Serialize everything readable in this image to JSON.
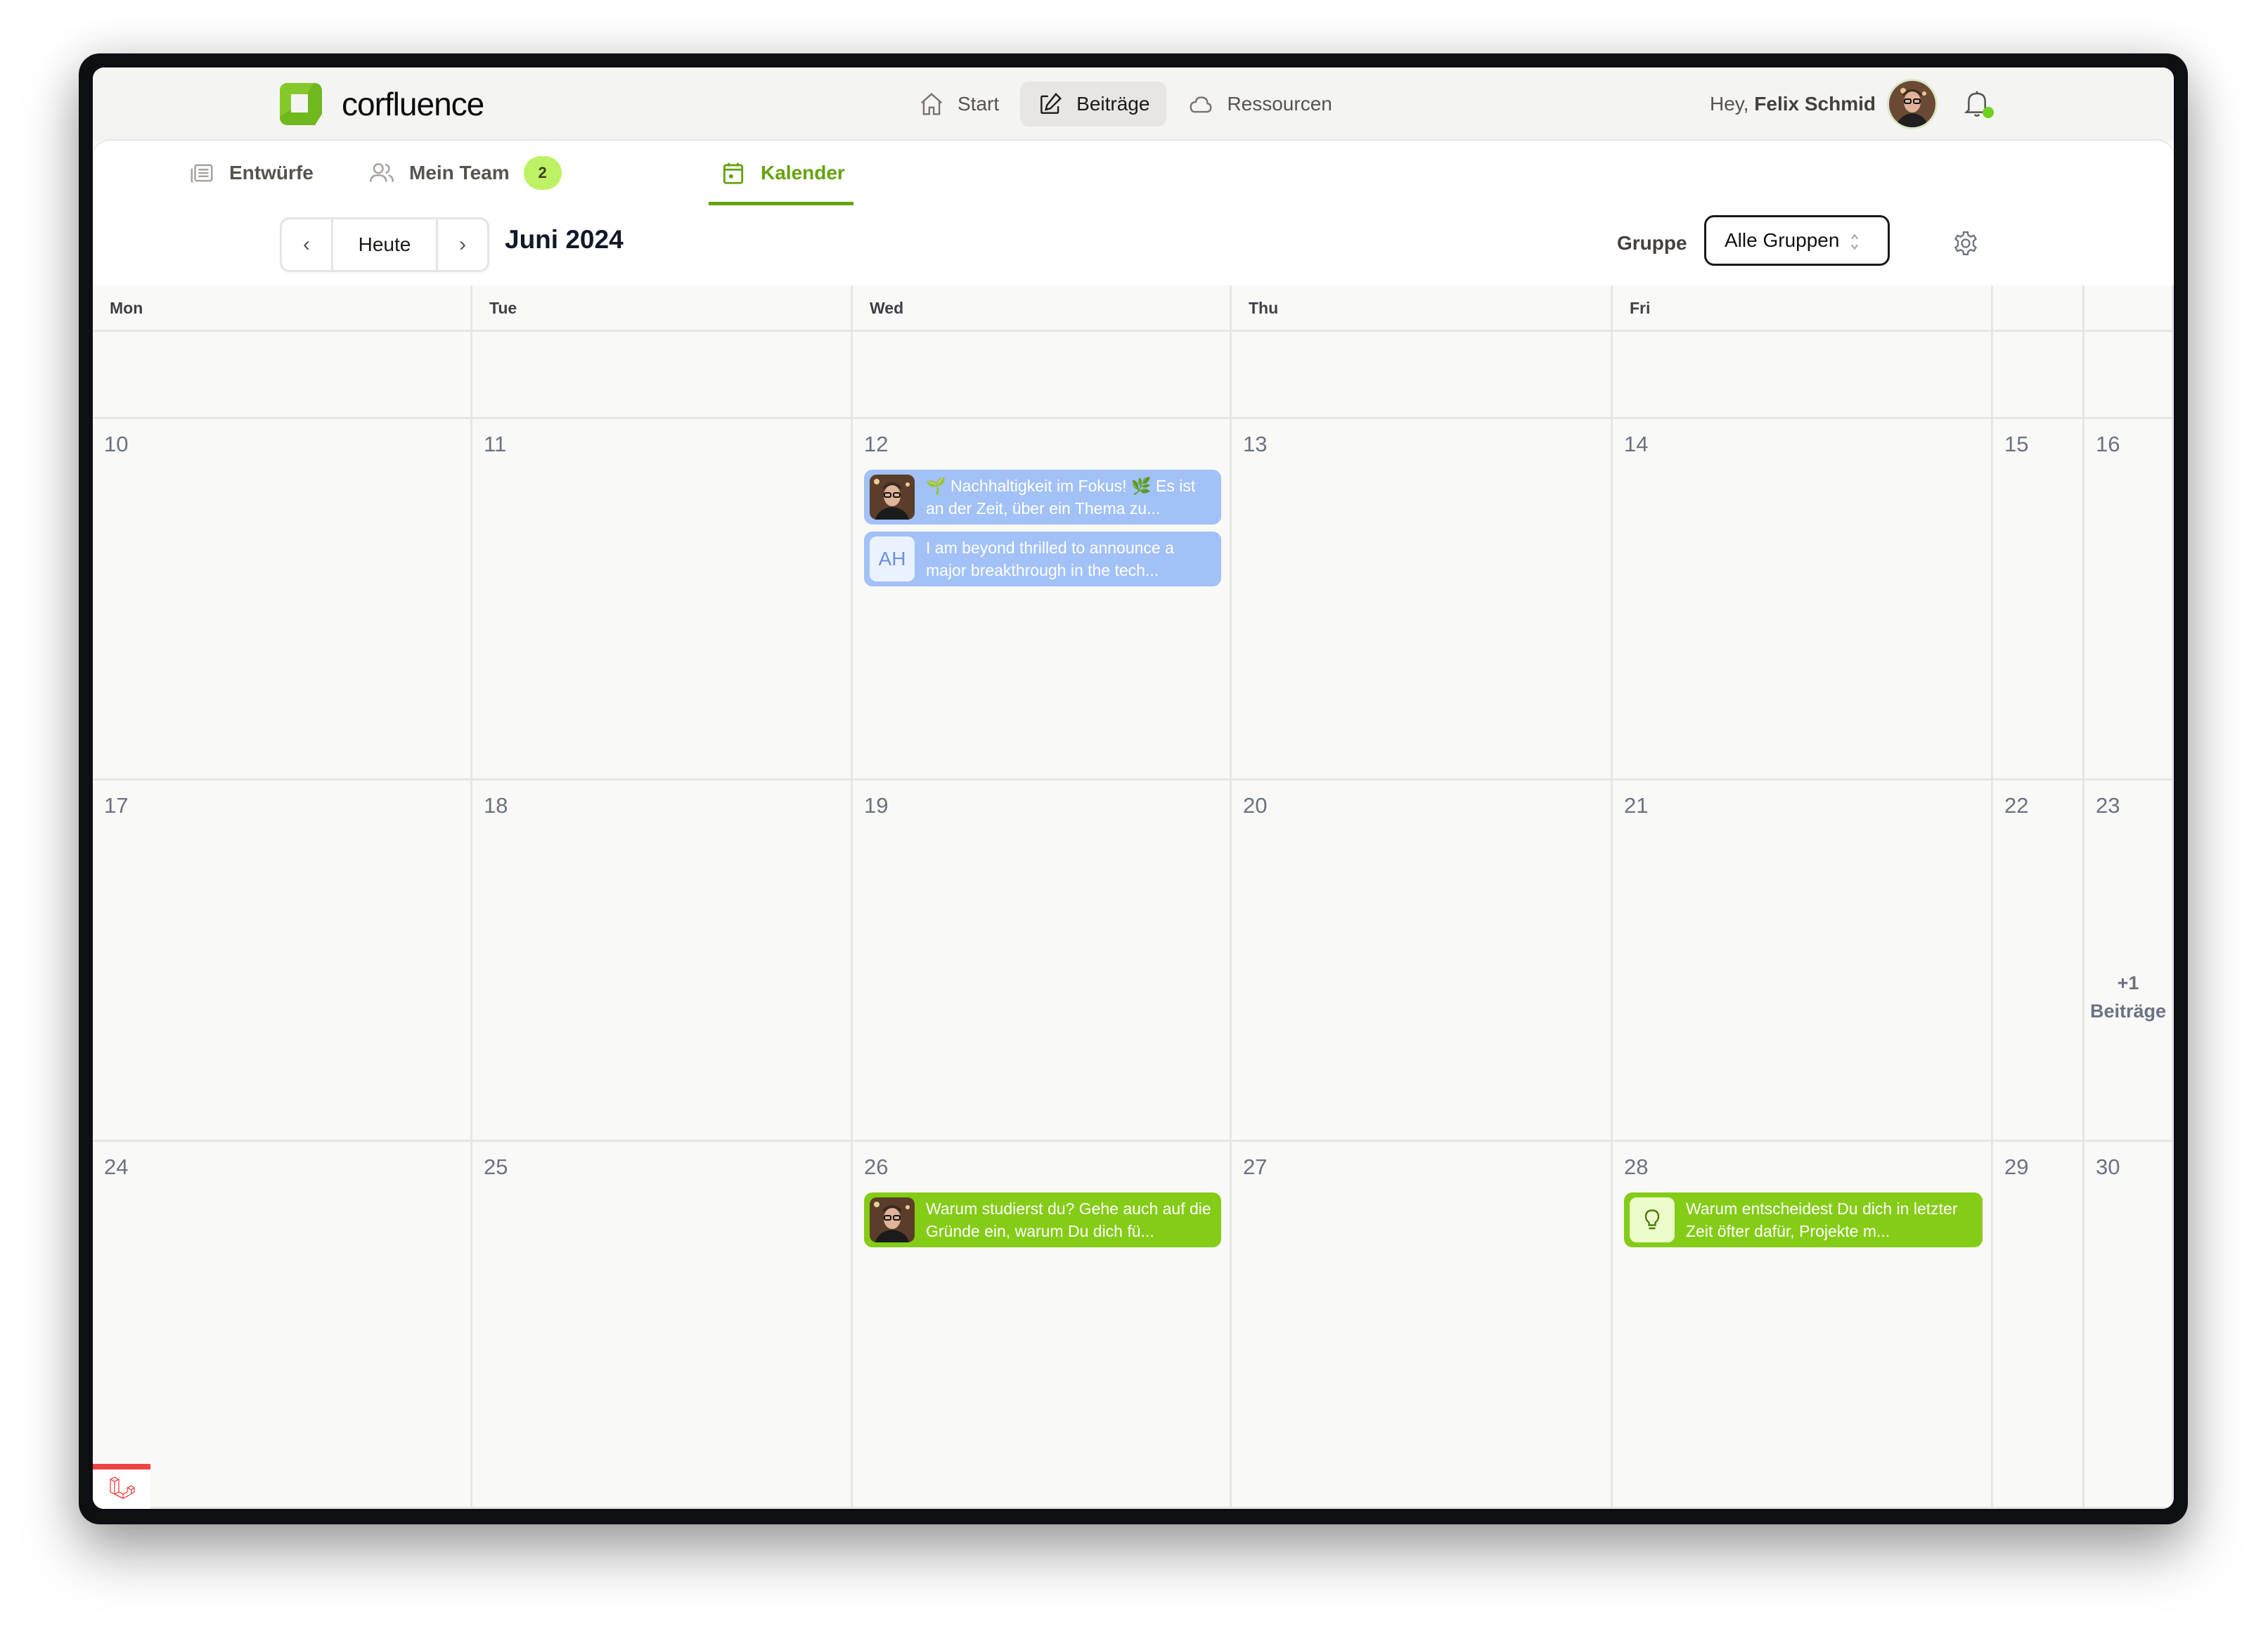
{
  "app": {
    "name": "corfluence"
  },
  "nav": {
    "items": [
      {
        "label": "Start",
        "icon": "home-icon"
      },
      {
        "label": "Beiträge",
        "icon": "edit-icon",
        "active": true
      },
      {
        "label": "Ressourcen",
        "icon": "cloud-icon"
      }
    ]
  },
  "user": {
    "greeting": "Hey,",
    "name": "Felix Schmid",
    "notification_status_color": "#6fcf1f"
  },
  "subtabs": [
    {
      "label": "Entwürfe",
      "icon": "drafts-icon"
    },
    {
      "label": "Mein Team",
      "icon": "team-icon",
      "badge": "2"
    },
    {
      "label": "Kalender",
      "icon": "calendar-icon",
      "active": true
    }
  ],
  "toolbar": {
    "prev_label": "‹",
    "today_label": "Heute",
    "next_label": "›",
    "month_title": "Juni 2024",
    "group_label": "Gruppe",
    "group_selected": "Alle Gruppen"
  },
  "calendar": {
    "weekdays": [
      "Mon",
      "Tue",
      "Wed",
      "Thu",
      "Fri",
      "",
      ""
    ],
    "weeks": [
      {
        "days": [
          "",
          "",
          "",
          "",
          "",
          "",
          ""
        ]
      },
      {
        "days": [
          "10",
          "11",
          "12",
          "13",
          "14",
          "15",
          "16"
        ]
      },
      {
        "days": [
          "17",
          "18",
          "19",
          "20",
          "21",
          "22",
          "23"
        ]
      },
      {
        "days": [
          "24",
          "25",
          "26",
          "27",
          "28",
          "29",
          "30"
        ]
      }
    ],
    "events": {
      "d12_a": {
        "text": "🌱 Nachhaltigkeit im Fokus! 🌿 Es ist an der Zeit, über ein Thema zu...",
        "color": "#a2c1f7",
        "thumb": "avatar-photo"
      },
      "d12_b": {
        "text": "I am beyond thrilled to announce a major breakthrough in the tech...",
        "color": "#a2c1f7",
        "thumb_initials": "AH"
      },
      "d26_a": {
        "text": "Warum studierst du? Gehe auch auf die Gründe ein, warum Du dich fü...",
        "color": "#84cc16",
        "thumb": "avatar-photo"
      },
      "d28_a": {
        "text": "Warum entscheidest Du dich in letzter Zeit öfter dafür, Projekte m...",
        "color": "#84cc16",
        "thumb": "lightbulb-icon"
      }
    },
    "more_23": {
      "count": "+1",
      "label": "Beiträge"
    }
  },
  "colors": {
    "accent": "#65a30d",
    "badge_bg": "#bef264",
    "event_blue": "#a2c1f7",
    "event_green": "#84cc16",
    "debug_red": "#ef4444"
  }
}
